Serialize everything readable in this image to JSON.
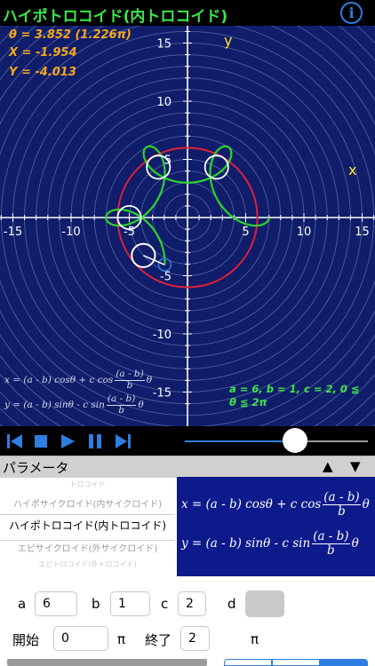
{
  "header": {
    "title": "ハイポトロコイド(内トロコイド)",
    "info_icon": "info-icon",
    "info_glyph": "i"
  },
  "readout": {
    "theta": "θ = 3.852 (1.226π)",
    "x": "X = -1.954",
    "y": "Y = -4.013"
  },
  "plot": {
    "x_label": "x",
    "y_label": "y",
    "x_ticks": [
      "-15",
      "-10",
      "-5",
      "5",
      "10",
      "15"
    ],
    "y_ticks": [
      "15",
      "10",
      "5",
      "-5",
      "-10",
      "-15"
    ],
    "colors": {
      "background": "#0f1d6a",
      "grid": "#5d6aa8",
      "axis": "#ffffff",
      "base_circle": "#e0203a",
      "curve": "#2bd62b",
      "rolling_circle": "#ffffff",
      "tracer": "#2e7de0"
    }
  },
  "curve_params": {
    "a": 6,
    "b": 1,
    "c": 2,
    "theta_start": 0,
    "theta_end": 2,
    "theta_current": 3.852
  },
  "formula": {
    "x_lhs": "x = (a - b) cosθ + c cos",
    "y_lhs": "y = (a - b) sinθ - c sin",
    "frac_num": "(a - b)",
    "frac_den": "b",
    "frac_tail": "θ"
  },
  "param_text": "a = 6, b = 1, c = 2, 0 ≦ θ ≦ 2π",
  "toolbar": {
    "icons": [
      "skip-back-icon",
      "stop-icon",
      "play-icon",
      "pause-icon",
      "skip-forward-icon"
    ],
    "slider_value": 0.6
  },
  "section": {
    "title": "パラメータ",
    "up": "▲",
    "down": "▼"
  },
  "picker": {
    "items": [
      "トロコイド",
      "ハイポサイクロイド(内サイクロイド)",
      "ハイポトロコイド(内トロコイド)",
      "エピサイクロイド(外サイクロイド)",
      "エピトロコイド(外トロコイド)"
    ],
    "selected_index": 2
  },
  "fields": {
    "a_label": "a",
    "a_value": "6",
    "b_label": "b",
    "b_value": "1",
    "c_label": "c",
    "c_value": "2",
    "d_label": "d",
    "d_value": "",
    "start_label": "開始",
    "start_value": "0",
    "start_unit": "π",
    "end_label": "終了",
    "end_value": "2",
    "end_unit": "π"
  }
}
